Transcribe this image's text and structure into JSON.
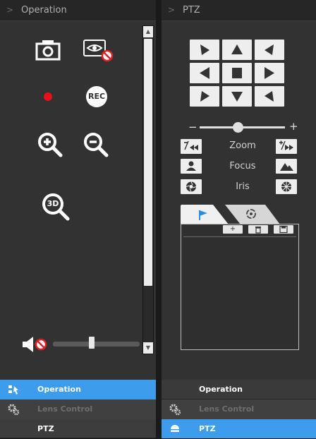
{
  "left_panel": {
    "header_title": "Operation",
    "snapshot_icon": "camera-icon",
    "privacy_icon": "eye-blocked-icon",
    "record_icon": "record-dot-icon",
    "rec_label": "REC",
    "zoom_in_icon": "zoom-in-icon",
    "zoom_out_icon": "zoom-out-icon",
    "zoom_3d_label": "3D",
    "volume": {
      "icon": "mute-speaker-icon",
      "level": 0.45
    }
  },
  "right_panel": {
    "header_title": "PTZ",
    "speed": {
      "min_label": "−",
      "max_label": "+",
      "level": 0.45
    },
    "zoom": {
      "label": "Zoom",
      "minus_icon": "zoom-minus-icon",
      "plus_icon": "zoom-plus-icon"
    },
    "focus": {
      "label": "Focus",
      "near_icon": "person-icon",
      "far_icon": "mountain-icon"
    },
    "iris": {
      "label": "Iris",
      "close_icon": "iris-close-icon",
      "open_icon": "iris-open-icon"
    },
    "tabs": [
      {
        "icon": "flag-icon"
      },
      {
        "icon": "cruise-icon"
      }
    ],
    "tool_buttons": [
      {
        "icon": "plus-icon",
        "text": "+"
      },
      {
        "icon": "trash-icon",
        "text": ""
      },
      {
        "icon": "save-icon",
        "text": ""
      }
    ]
  },
  "nav": {
    "left": [
      {
        "label": "Operation",
        "state": "active",
        "icon": "operation-icon"
      },
      {
        "label": "Lens Control",
        "state": "disabled",
        "icon": "gears-icon"
      },
      {
        "label": "PTZ",
        "state": "inactive",
        "icon": ""
      }
    ],
    "right": [
      {
        "label": "Operation",
        "state": "inactive",
        "icon": ""
      },
      {
        "label": "Lens Control",
        "state": "disabled",
        "icon": "gears-icon"
      },
      {
        "label": "PTZ",
        "state": "active",
        "icon": "dome-camera-icon"
      }
    ]
  },
  "colors": {
    "accent": "#3d9ceb",
    "panel": "#323232",
    "header": "#262626",
    "record": "#e8101a",
    "block": "#e02020"
  }
}
